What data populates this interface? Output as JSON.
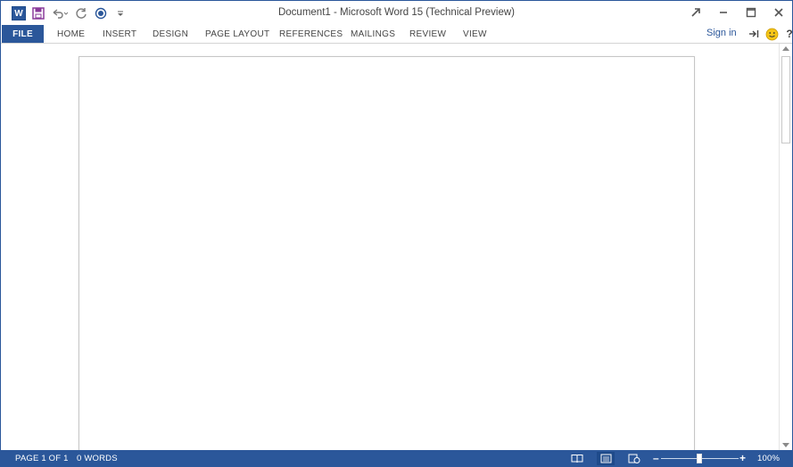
{
  "titlebar": {
    "title": "Document1 - Microsoft Word 15 (Technical Preview)",
    "qat_icons": [
      "word-app-icon",
      "save-icon",
      "undo-icon",
      "redo-icon",
      "touch-mode-icon",
      "customize-qat-icon"
    ]
  },
  "ribbon": {
    "file_label": "FILE",
    "tabs": [
      "HOME",
      "INSERT",
      "DESIGN",
      "PAGE LAYOUT",
      "REFERENCES",
      "MAILINGS",
      "REVIEW",
      "VIEW"
    ],
    "signin_label": "Sign in"
  },
  "statusbar": {
    "page_info": "PAGE 1 OF 1",
    "word_count": "0 WORDS",
    "zoom_percent": 100,
    "zoom_label": "100%"
  },
  "colors": {
    "accent": "#2b579a",
    "statusbar": "#2b579a"
  }
}
